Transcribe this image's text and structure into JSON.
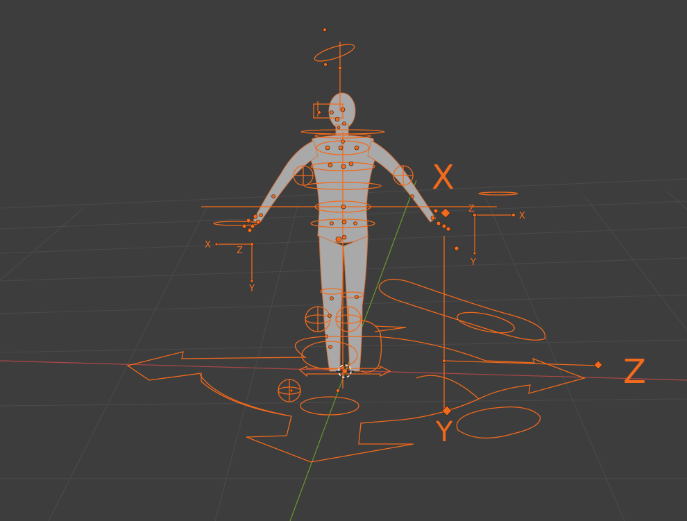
{
  "viewport": {
    "background": "#3d3d3d",
    "grid_color": "#4b4b4b",
    "x_axis_color": "#b04848",
    "y_axis_color": "#6a9a2a",
    "rig_color": "#f26a1b",
    "mesh_color": "#a9a9a9"
  },
  "labels": {
    "big_x": "X",
    "left_x": "X",
    "left_z": "Z",
    "left_y": "Y",
    "right_x": "X",
    "right_z": "Z",
    "right_y": "Y",
    "root_z": "Z",
    "root_y": "Y"
  },
  "icons": {
    "origin": "3d-cursor-icon"
  }
}
